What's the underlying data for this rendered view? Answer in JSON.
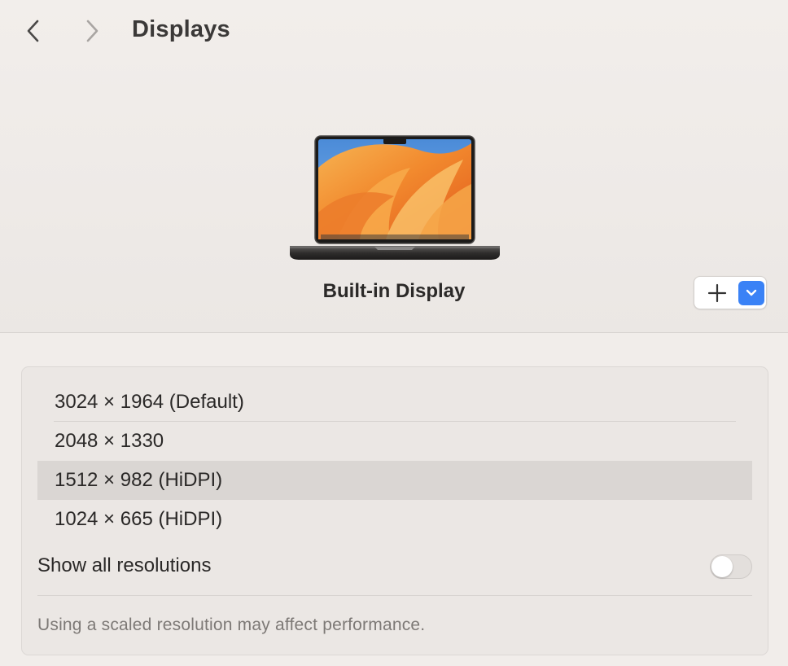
{
  "header": {
    "title": "Displays"
  },
  "display": {
    "name": "Built-in Display"
  },
  "resolutions": {
    "items": [
      {
        "label": "3024 × 1964 (Default)"
      },
      {
        "label": "2048 × 1330"
      },
      {
        "label": "1512 × 982 (HiDPI)"
      },
      {
        "label": "1024 × 665 (HiDPI)"
      }
    ],
    "selected_index": 2,
    "show_all_label": "Show all resolutions",
    "show_all_enabled": false,
    "footnote": "Using a scaled resolution may affect performance."
  },
  "colors": {
    "accent": "#3a82f6",
    "selected_row": "#dad6d3",
    "background": "#f1edea"
  },
  "icons": {
    "back": "chevron-left-icon",
    "forward": "chevron-right-icon",
    "add": "plus-icon",
    "dropdown": "chevron-down-icon"
  }
}
